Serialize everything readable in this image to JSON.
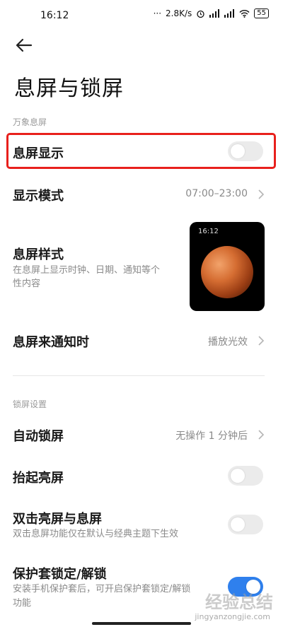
{
  "status_bar": {
    "time": "16:12",
    "dots": "···",
    "speed": "2.8K/s",
    "battery": "55"
  },
  "page": {
    "title": "息屏与锁屏"
  },
  "section_aod": {
    "label": "万象息屏"
  },
  "aod_display": {
    "title": "息屏显示",
    "enabled": false
  },
  "display_mode": {
    "title": "显示模式",
    "value": "07:00–23:00"
  },
  "aod_style": {
    "title": "息屏样式",
    "subtitle_line1": "在息屏上显示时钟、日期、通知等个",
    "subtitle_line2": "性内容",
    "preview_time": "16:12"
  },
  "aod_notification": {
    "title": "息屏来通知时",
    "value": "播放光效"
  },
  "section_lock": {
    "label": "锁屏设置"
  },
  "auto_lock": {
    "title": "自动锁屏",
    "value": "无操作 1 分钟后"
  },
  "raise_to_wake": {
    "title": "抬起亮屏",
    "enabled": false
  },
  "double_tap": {
    "title": "双击亮屏与息屏",
    "subtitle": "双击息屏功能仅在默认与经典主题下生效",
    "enabled": false
  },
  "case_lock": {
    "title": "保护套锁定/解锁",
    "subtitle_line1": "安装手机保护套后，可开启保护套锁定/解锁",
    "subtitle_line2": "功能",
    "enabled": true
  },
  "watermark": {
    "text": "经验总结",
    "url": "jingyanzongjie.com"
  },
  "colors": {
    "highlight": "#e8201c",
    "toggle_on": "#2f80ed",
    "toggle_off": "#ebebeb"
  }
}
